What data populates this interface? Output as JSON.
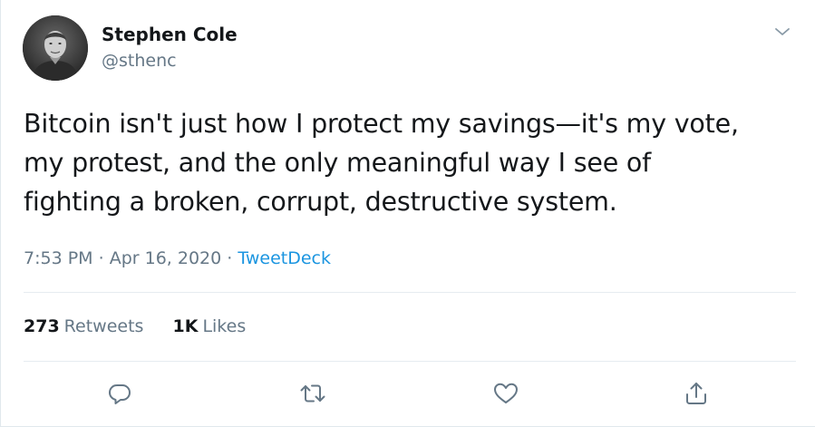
{
  "author": {
    "name": "Stephen Cole",
    "handle": "@sthenc"
  },
  "tweet": {
    "lines": [
      "Bitcoin isn't just how I protect my savings—it's my vote,",
      "my protest, and the only meaningful way I see of",
      "fighting a broken, corrupt, destructive system."
    ]
  },
  "meta": {
    "time": "7:53 PM",
    "separator": "·",
    "date": "Apr 16, 2020",
    "source": "TweetDeck"
  },
  "stats": {
    "retweets_count": "273",
    "retweets_label": "Retweets",
    "likes_count": "1K",
    "likes_label": "Likes"
  },
  "icons": {
    "caret": "chevron-down-icon",
    "reply": "reply-icon",
    "retweet": "retweet-icon",
    "like": "heart-icon",
    "share": "share-icon"
  },
  "colors": {
    "text": "#14171a",
    "secondary": "#657786",
    "link": "#1b95e0",
    "divider": "#e6ecf0"
  }
}
